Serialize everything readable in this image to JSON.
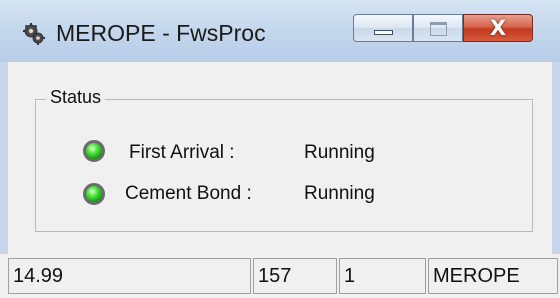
{
  "window": {
    "title": "MEROPE - FwsProc",
    "icon": "gear-icon",
    "buttons": {
      "minimize": "minimize-icon",
      "maximize": "maximize-icon",
      "close": "X"
    }
  },
  "status_group": {
    "label": "Status",
    "items": [
      {
        "label": "First Arrival :",
        "value": "Running",
        "indicator": "green"
      },
      {
        "label": "Cement Bond :",
        "value": "Running",
        "indicator": "green"
      }
    ]
  },
  "statusbar": {
    "panels": [
      "14.99",
      "157",
      "1",
      "MEROPE"
    ]
  },
  "colors": {
    "indicator_on": "#2fd11c",
    "titlebar": "#c2d5ec",
    "close_button": "#c33a1f"
  }
}
